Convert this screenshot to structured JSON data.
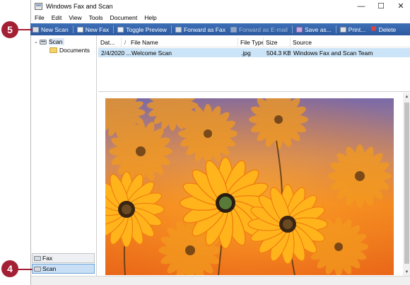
{
  "window": {
    "title": "Windows Fax and Scan"
  },
  "window_controls": {
    "minimize": "—",
    "maximize": "☐",
    "close": "✕"
  },
  "menu": [
    "File",
    "Edit",
    "View",
    "Tools",
    "Document",
    "Help"
  ],
  "toolbar": {
    "new_scan": "New Scan",
    "new_fax": "New Fax",
    "toggle_preview": "Toggle Preview",
    "forward_fax": "Forward as Fax",
    "forward_email": "Forward as E-mail",
    "save_as": "Save as...",
    "print": "Print...",
    "delete": "Delete"
  },
  "tree": {
    "scan": "Scan",
    "documents": "Documents"
  },
  "left_buttons": {
    "fax": "Fax",
    "scan": "Scan"
  },
  "list": {
    "columns": [
      "Dat...",
      "/",
      "File Name",
      "File Type",
      "Size",
      "Source"
    ],
    "rows": [
      {
        "date": "2/4/2020 ...",
        "file_name": "Welcome Scan",
        "file_type": ".jpg",
        "size": "504.3 KB",
        "source": "Windows Fax and Scan Team"
      }
    ]
  },
  "callouts": {
    "top": "5",
    "bottom": "4"
  },
  "colors": {
    "toolbar": "#2f5ea4",
    "callout": "#a31f34",
    "selection": "#cce4f7"
  }
}
